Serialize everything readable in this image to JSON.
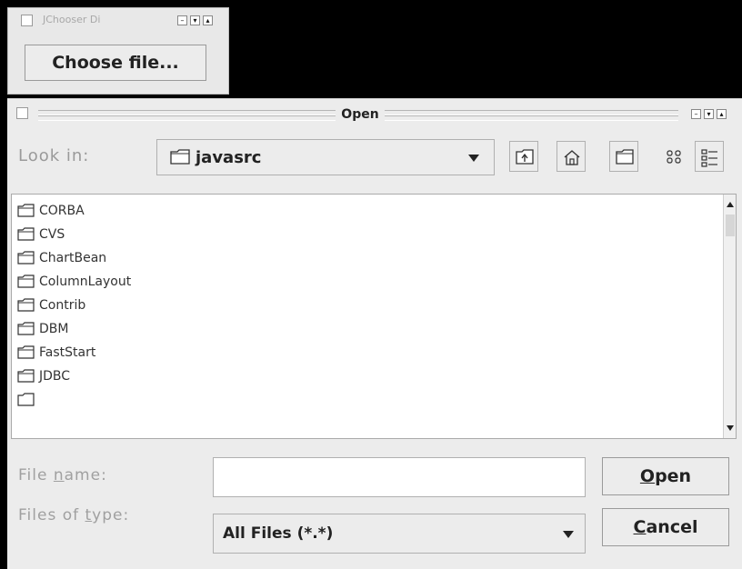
{
  "mini_frame": {
    "title": "JChooser Di",
    "choose_file_label": "Choose file..."
  },
  "dialog": {
    "title": "Open",
    "look_in_label": "Look in:",
    "look_in_value": "javasrc",
    "toolbar_icons": [
      "up-folder-icon",
      "home-icon",
      "new-folder-icon",
      "list-view-icon",
      "details-view-icon"
    ],
    "files": [
      "CORBA",
      "CVS",
      "ChartBean",
      "ColumnLayout",
      "Contrib",
      "DBM",
      "FastStart",
      "JDBC"
    ],
    "file_name_label": "File name:",
    "file_name_value": "",
    "files_of_type_label": "Files of type:",
    "files_of_type_value": "All Files (*.*)",
    "open_label": "Open",
    "cancel_label": "Cancel"
  }
}
